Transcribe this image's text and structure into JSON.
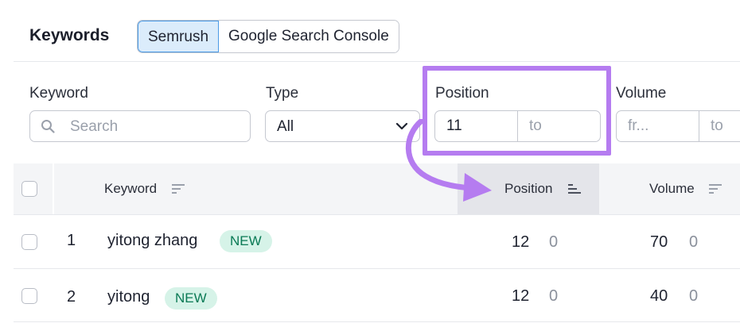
{
  "header": {
    "title": "Keywords",
    "sources": [
      {
        "label": "Semrush",
        "active": true
      },
      {
        "label": "Google Search Console",
        "active": false
      }
    ]
  },
  "filters": {
    "keyword": {
      "label": "Keyword",
      "placeholder": "Search"
    },
    "type": {
      "label": "Type",
      "value": "All"
    },
    "position": {
      "label": "Position",
      "from": "11",
      "to_placeholder": "to"
    },
    "volume": {
      "label": "Volume",
      "from_placeholder": "fr...",
      "to_placeholder": "to"
    }
  },
  "table": {
    "columns": {
      "keyword": "Keyword",
      "position": "Position",
      "volume": "Volume"
    },
    "rows": [
      {
        "index": "1",
        "keyword": "yitong zhang",
        "badge": "NEW",
        "position": "12",
        "position_change": "0",
        "volume": "70",
        "volume_change": "0"
      },
      {
        "index": "2",
        "keyword": "yitong",
        "badge": "NEW",
        "position": "12",
        "position_change": "0",
        "volume": "40",
        "volume_change": "0"
      }
    ]
  },
  "colors": {
    "highlight": "#b57cf0",
    "active_tab_bg": "#dbecfb",
    "active_tab_border": "#4b9be6",
    "badge_bg": "#d6f3e8",
    "badge_text": "#0a7a55"
  }
}
